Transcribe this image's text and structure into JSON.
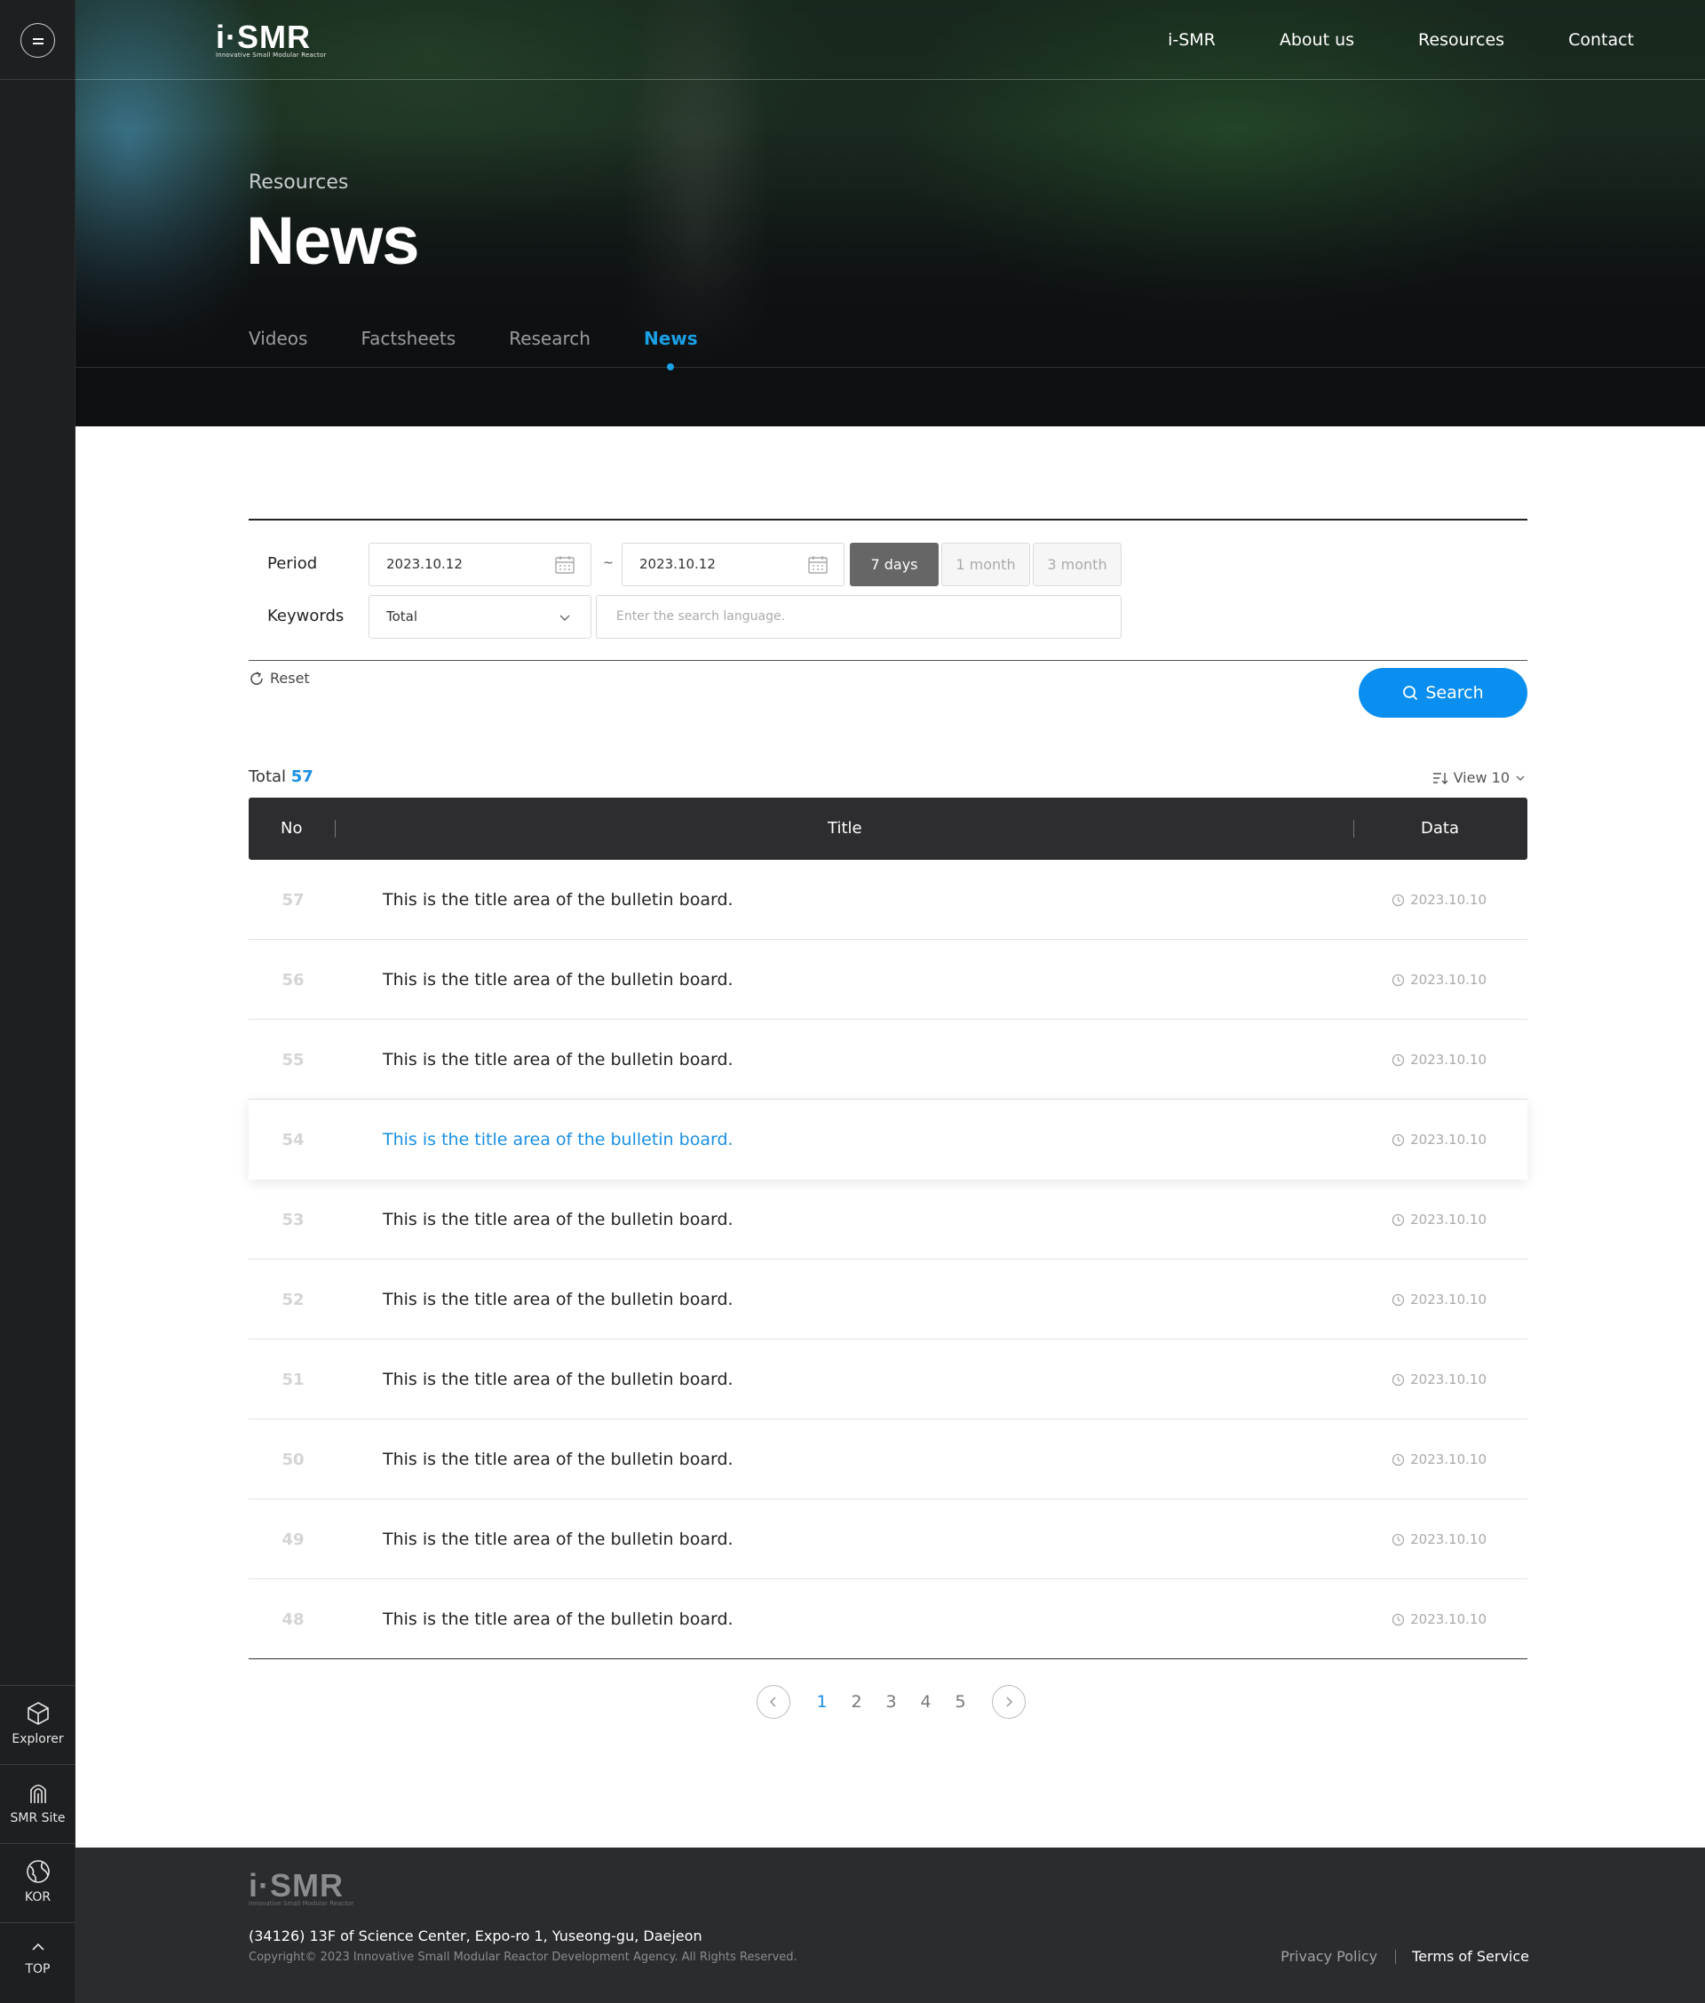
{
  "brand": {
    "logo": "i·SMR",
    "tagline": "Innovative Small Modular Reactor"
  },
  "nav": [
    "i-SMR",
    "About us",
    "Resources",
    "Contact"
  ],
  "hero": {
    "kicker": "Resources",
    "title": "News"
  },
  "tabs": [
    {
      "label": "Videos",
      "active": false
    },
    {
      "label": "Factsheets",
      "active": false
    },
    {
      "label": "Research",
      "active": false
    },
    {
      "label": "News",
      "active": true
    }
  ],
  "sidebar_tools": [
    {
      "label": "Explorer",
      "icon": "cube-icon"
    },
    {
      "label": "SMR Site",
      "icon": "site-icon"
    },
    {
      "label": "KOR",
      "icon": "globe-icon"
    },
    {
      "label": "TOP",
      "icon": "arrow-up-icon"
    }
  ],
  "filter": {
    "period_label": "Period",
    "start_date": "2023.10.12",
    "separator": "~",
    "end_date": "2023.10.12",
    "period_buttons": [
      {
        "label": "7 days",
        "active": true
      },
      {
        "label": "1 month",
        "active": false
      },
      {
        "label": "3 month",
        "active": false
      }
    ],
    "keywords_label": "Keywords",
    "keyword_scope": "Total",
    "keyword_placeholder": "Enter the search language.",
    "reset_label": "Reset",
    "search_label": "Search"
  },
  "list": {
    "total_label": "Total",
    "total_count": "57",
    "view_label": "View 10",
    "columns": {
      "no": "No",
      "title": "Title",
      "date": "Data"
    },
    "rows": [
      {
        "no": "57",
        "title": "This is the title area of the bulletin board.",
        "date": "2023.10.10"
      },
      {
        "no": "56",
        "title": "This is the title area of the bulletin board.",
        "date": "2023.10.10"
      },
      {
        "no": "55",
        "title": "This is the title area of the bulletin board.",
        "date": "2023.10.10"
      },
      {
        "no": "54",
        "title": "This is the title area of the bulletin board.",
        "date": "2023.10.10",
        "highlighted": true
      },
      {
        "no": "53",
        "title": "This is the title area of the bulletin board.",
        "date": "2023.10.10"
      },
      {
        "no": "52",
        "title": "This is the title area of the bulletin board.",
        "date": "2023.10.10"
      },
      {
        "no": "51",
        "title": "This is the title area of the bulletin board.",
        "date": "2023.10.10"
      },
      {
        "no": "50",
        "title": "This is the title area of the bulletin board.",
        "date": "2023.10.10"
      },
      {
        "no": "49",
        "title": "This is the title area of the bulletin board.",
        "date": "2023.10.10"
      },
      {
        "no": "48",
        "title": "This is the title area of the bulletin board.",
        "date": "2023.10.10"
      }
    ]
  },
  "pagination": {
    "pages": [
      "1",
      "2",
      "3",
      "4",
      "5"
    ],
    "current": "1"
  },
  "footer": {
    "address": "(34126) 13F of Science Center, Expo-ro 1, Yuseong-gu, Daejeon",
    "copyright": "Copyright© 2023 Innovative Small Modular Reactor Development Agency. All Rights Reserved.",
    "privacy": "Privacy Policy",
    "terms": "Terms of Service"
  },
  "colors": {
    "accent": "#1a8fe3",
    "search_button": "#0a8ff0",
    "table_header": "#2d2d2f",
    "sidebar": "#1e1f21",
    "footer": "#2b2c2f"
  }
}
